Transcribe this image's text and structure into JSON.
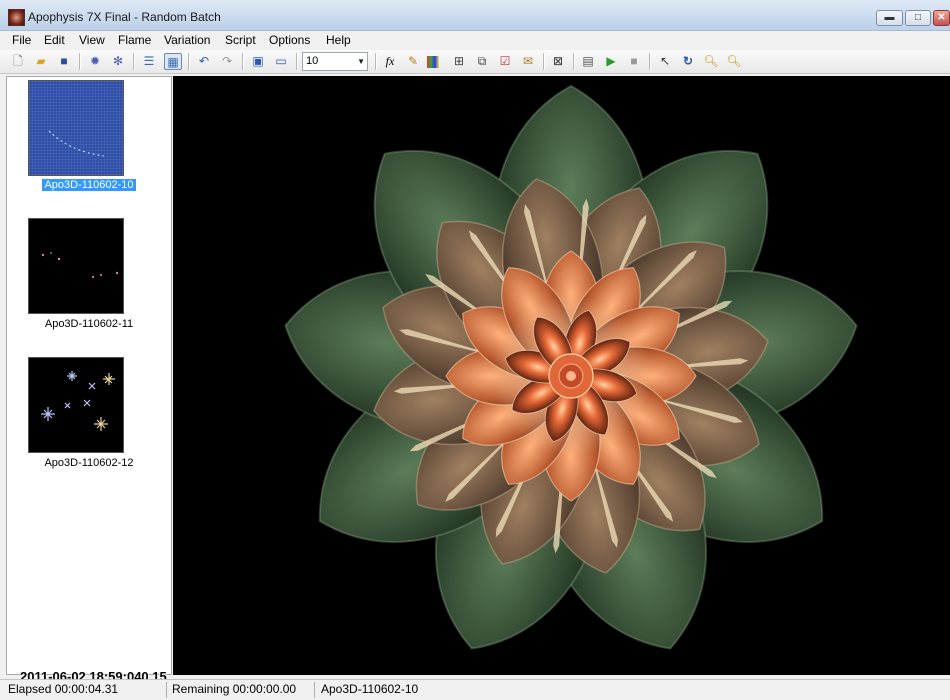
{
  "window": {
    "title": "Apophysis 7X Final - Random Batch",
    "buttons": {
      "minimize": "▬",
      "maximize": "□",
      "close": "✕"
    }
  },
  "menu": [
    "File",
    "Edit",
    "View",
    "Flame",
    "Variation",
    "Script",
    "Options",
    "Help"
  ],
  "toolbar": {
    "quality_value": "10",
    "icons": [
      "new-file-icon",
      "open-folder-icon",
      "save-icon",
      "render-gear-icon",
      "batch-gears-icon",
      "list-view-icon",
      "icon-view-icon",
      "undo-icon",
      "redo-icon",
      "fullscreen-icon",
      "preview-window-icon",
      "quality-select",
      "formula-icon",
      "edit-icon",
      "gradient-icon",
      "mutate-icon",
      "adjust-icon",
      "options-icon",
      "script-editor-icon",
      "reset-location-icon",
      "script-icon",
      "play-icon",
      "stop-icon",
      "select-cursor-icon",
      "rotate-icon",
      "zoom-in-icon",
      "zoom-out-icon"
    ]
  },
  "flames": [
    {
      "label": "Apo3D-110602-10",
      "selected": true
    },
    {
      "label": "Apo3D-110602-11",
      "selected": false
    },
    {
      "label": "Apo3D-110602-12",
      "selected": false
    }
  ],
  "timestamp": "2011-06-02 18:59:040.15",
  "status": {
    "elapsed": "Elapsed 00:00:04.31",
    "remaining": "Remaining 00:00:00.00",
    "current": "Apo3D-110602-10"
  },
  "colors": {
    "selection": "#3399ff",
    "petal_outer": "#2f4a30",
    "petal_mid": "#7a5a45",
    "petal_inner": "#d9703f",
    "render_bg": "#000000"
  }
}
